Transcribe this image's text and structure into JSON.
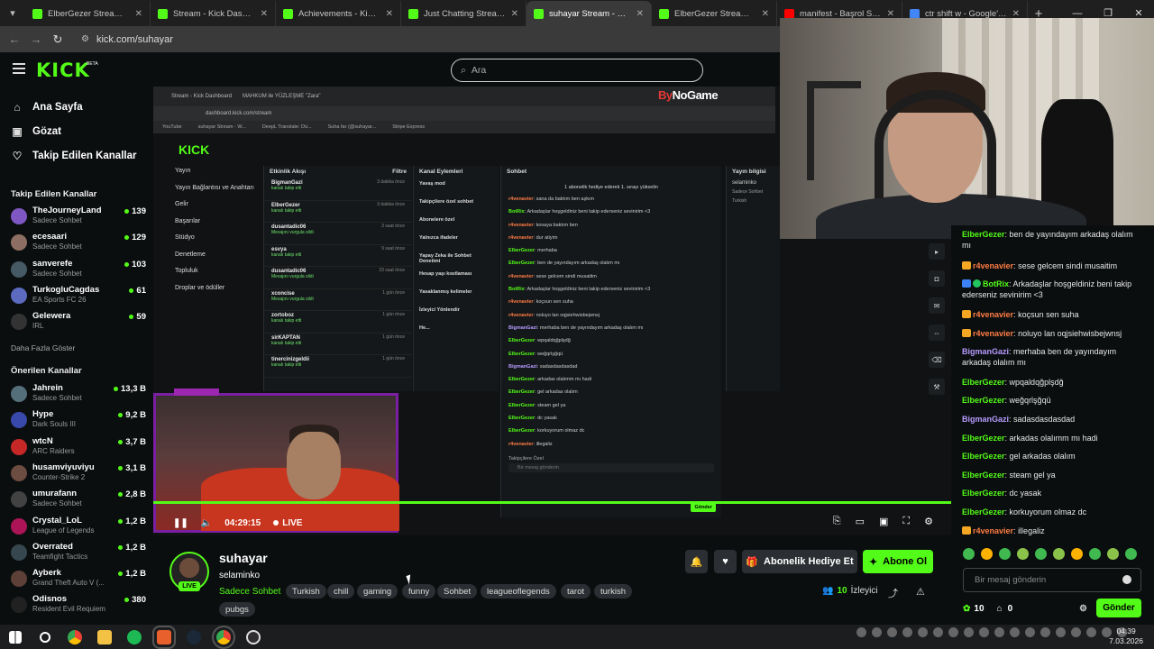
{
  "browser": {
    "tabs": [
      {
        "title": "ElberGezer Stream - Watc",
        "color": "#53fc18"
      },
      {
        "title": "Stream - Kick Dashboard",
        "color": "#53fc18"
      },
      {
        "title": "Achievements - Kick Dash",
        "color": "#53fc18"
      },
      {
        "title": "Just Chatting Streaming -",
        "color": "#53fc18"
      },
      {
        "title": "suhayar Stream - Wat",
        "color": "#53fc18",
        "active": true
      },
      {
        "title": "ElberGezer Stream - Watc",
        "color": "#53fc18"
      },
      {
        "title": "manifest - Başrol Sensin |",
        "color": "#ff0000"
      },
      {
        "title": "ctr shift w - Google'da Ar",
        "color": "#4285f4"
      }
    ],
    "new_tab_icon": "+",
    "url": "kick.com/suhayar"
  },
  "header": {
    "logo": "KICK",
    "logo_beta": "BETA",
    "search_placeholder": "Ara"
  },
  "sidebar": {
    "nav": [
      {
        "label": "Ana Sayfa",
        "icon": "home-icon"
      },
      {
        "label": "Gözat",
        "icon": "browse-icon"
      },
      {
        "label": "Takip Edilen Kanallar",
        "icon": "heart-icon"
      }
    ],
    "followed_title": "Takip Edilen Kanallar",
    "followed": [
      {
        "name": "TheJourneyLand",
        "category": "Sadece Sohbet",
        "viewers": "139",
        "color": "#7e57c2"
      },
      {
        "name": "ecesaari",
        "category": "Sadece Sohbet",
        "viewers": "129",
        "color": "#8d6e63"
      },
      {
        "name": "sanverefe",
        "category": "Sadece Sohbet",
        "viewers": "103",
        "color": "#455a64"
      },
      {
        "name": "TurkogluCagdas",
        "category": "EA Sports FC 26",
        "viewers": "61",
        "color": "#5c6bc0"
      },
      {
        "name": "Gelewera",
        "category": "IRL",
        "viewers": "59",
        "color": "#333333"
      }
    ],
    "show_more": "Daha Fazla Göster",
    "recommended_title": "Önerilen Kanallar",
    "recommended": [
      {
        "name": "Jahrein",
        "category": "Sadece Sohbet",
        "viewers": "13,3 B",
        "color": "#546e7a"
      },
      {
        "name": "Hype",
        "category": "Dark Souls III",
        "viewers": "9,2 B",
        "color": "#3949ab"
      },
      {
        "name": "wtcN",
        "category": "ARC Raiders",
        "viewers": "3,7 B",
        "color": "#c62828"
      },
      {
        "name": "husamviyuviyu",
        "category": "Counter-Strike 2",
        "viewers": "3,1 B",
        "color": "#6d4c41"
      },
      {
        "name": "umurafann",
        "category": "Sadece Sohbet",
        "viewers": "2,8 B",
        "color": "#424242"
      },
      {
        "name": "Crystal_LoL",
        "category": "League of Legends",
        "viewers": "1,2 B",
        "color": "#ad1457"
      },
      {
        "name": "Overrated",
        "category": "Teamfight Tactics",
        "viewers": "1,2 B",
        "color": "#37474f"
      },
      {
        "name": "Ayberk",
        "category": "Grand Theft Auto V (...",
        "viewers": "1,2 B",
        "color": "#5d4037"
      },
      {
        "name": "Odisnos",
        "category": "Resident Evil Requiem",
        "viewers": "380",
        "color": "#212121"
      }
    ]
  },
  "video": {
    "time": "04:29:15",
    "live": "LIVE",
    "inner": {
      "tabs": [
        "Stream - Kick Dashboard",
        "MAHKUM ile YÜZLEŞME \"Zara\""
      ],
      "url": "dashboard.kick.com/stream",
      "bookmarks": [
        "YouTube",
        "suhayar Stream - W...",
        "DeepL Translate: Dü...",
        "Suha far (@suhayar...",
        "Stripe Express"
      ],
      "sponsor_prefix": "By",
      "sponsor": "NoGame",
      "logo": "KICK",
      "nav": [
        "Yayın",
        "Yayın Bağlantısı ve Anahtarı",
        "Gelir",
        "Başarılar",
        "Stüdyo",
        "Denetleme",
        "Topluluk",
        "Droplar ve ödüller"
      ],
      "activity_title": "Etkinlik Akışı",
      "activity_filter": "Filtre",
      "activity": [
        {
          "name": "BigmanGazi",
          "sub": "kanalı takip etti",
          "time": "3 dakika önce"
        },
        {
          "name": "ElberGezer",
          "sub": "kanalı takip etti",
          "time": "3 dakika önce"
        },
        {
          "name": "dusantadic06",
          "sub": "Mesajını vurgula sildi",
          "time": "3 saat önce"
        },
        {
          "name": "esvya",
          "sub": "kanalı takip etti",
          "time": "9 saat önce"
        },
        {
          "name": "dusantadic06",
          "sub": "Mesajını vurgula sildi",
          "time": "23 saat önce"
        },
        {
          "name": "xconcise",
          "sub": "Mesajını vurgula sildi",
          "time": "1 gün önce"
        },
        {
          "name": "zortoboz",
          "sub": "kanalı takip etti",
          "time": "1 gün önce"
        },
        {
          "name": "sirKAPTAN",
          "sub": "kanalı takip etti",
          "time": "1 gün önce"
        },
        {
          "name": "tinercinizgeldii",
          "sub": "kanalı takip etti",
          "time": "1 gün önce"
        }
      ],
      "actions_title": "Kanal Eylemleri",
      "actions": [
        "Yavaş mod",
        "Takipçilere özel sohbet",
        "Abonelere özel",
        "Yalnızca ifadeler",
        "Yapay Zeka ile Sohbet Denetimi",
        "Hesap yaşı kısıtlaması",
        "Yasaklanmış kelimeler",
        "İzleyici Yönlendir",
        "He..."
      ],
      "chat_title": "Sohbet",
      "chat_banner": "1 abonelik hediye ederek 1. sırayı yükselin",
      "chat_lines": [
        {
          "user": "r4venavier",
          "text": "sana da baktım ben aşkım",
          "c": "r"
        },
        {
          "user": "BotRix",
          "text": "Arkadaşlar hoşgeldiniz beni takip ederseniz sevinirim <3",
          "c": "g"
        },
        {
          "user": "r4venavier",
          "text": "kovaya baktım ben",
          "c": "r"
        },
        {
          "user": "r4venavier",
          "text": "dur atiyim",
          "c": "r"
        },
        {
          "user": "ElberGezer",
          "text": "merhaba",
          "c": "g"
        },
        {
          "user": "ElberGezer",
          "text": "ben de yayındayım arkadaş olalım mı",
          "c": "g"
        },
        {
          "user": "r4venavier",
          "text": "sese gelcem sindi musaitim",
          "c": "r"
        },
        {
          "user": "BotRix",
          "text": "Arkadaşlar hoşgeldiniz beni takip ederseniz sevinirim <3",
          "c": "g"
        },
        {
          "user": "r4venavier",
          "text": "koçsun sen suha",
          "c": "r"
        },
        {
          "user": "r4venavier",
          "text": "noluyo lan oqjsiehwisbejwnsj",
          "c": "r"
        },
        {
          "user": "BigmanGazi",
          "text": "merhaba ben de yayındayım arkadaş olalım mı",
          "c": "p"
        },
        {
          "user": "ElberGezer",
          "text": "wpqaldqğplşdğ",
          "c": "g"
        },
        {
          "user": "ElberGezer",
          "text": "weğqrlşğqü",
          "c": "g"
        },
        {
          "user": "BigmanGazi",
          "text": "sadasdasdasdad",
          "c": "p"
        },
        {
          "user": "ElberGezer",
          "text": "arkadas olalımm mı hadi",
          "c": "g"
        },
        {
          "user": "ElberGezer",
          "text": "gel arkadas olalım",
          "c": "g"
        },
        {
          "user": "ElberGezer",
          "text": "steam gel ya",
          "c": "g"
        },
        {
          "user": "ElberGezer",
          "text": "dc yasak",
          "c": "g"
        },
        {
          "user": "ElberGezer",
          "text": "korkuyorum olmaz dc",
          "c": "g"
        },
        {
          "user": "r4venavier",
          "text": "illegaliz",
          "c": "r"
        }
      ],
      "chat_placeholder": "Bir mesaj gönderin",
      "chat_follow_label": "Takipçilere Özel",
      "chat_send": "Gönder",
      "info_title": "Yayın bilgisi",
      "info_title_value": "selaminko",
      "info_tags": [
        "Sadece Sohbet",
        "Turkish"
      ]
    }
  },
  "chat": {
    "messages": [
      {
        "user": "ElberGezer",
        "text": "ben de yayındayım arkadaş olalım mı",
        "color": "#53fc18",
        "badges": []
      },
      {
        "user": "r4venavier",
        "text": "sese gelcem sindi musaitim",
        "color": "#ff7d45",
        "badges": [
          "crown"
        ]
      },
      {
        "user": "BotRix",
        "text": "Arkadaşlar hoşgeldiniz beni takip ederseniz sevinirim <3",
        "color": "#53fc18",
        "badges": [
          "bot",
          "ok"
        ]
      },
      {
        "user": "r4venavier",
        "text": "koçsun sen suha",
        "color": "#ff7d45",
        "badges": [
          "crown"
        ]
      },
      {
        "user": "r4venavier",
        "text": "noluyo lan oqjsiehwisbejwnsj",
        "color": "#ff7d45",
        "badges": [
          "crown"
        ]
      },
      {
        "user": "BigmanGazi",
        "text": "merhaba ben de yayındayım arkadaş olalım mı",
        "color": "#b69cff",
        "badges": []
      },
      {
        "user": "ElberGezer",
        "text": "wpqaldqğplşdğ",
        "color": "#53fc18",
        "badges": []
      },
      {
        "user": "ElberGezer",
        "text": "weğqrlşğqü",
        "color": "#53fc18",
        "badges": []
      },
      {
        "user": "BigmanGazi",
        "text": "sadasdasdasdad",
        "color": "#b69cff",
        "badges": []
      },
      {
        "user": "ElberGezer",
        "text": "arkadas olalımm mı hadi",
        "color": "#53fc18",
        "badges": []
      },
      {
        "user": "ElberGezer",
        "text": "gel arkadas olalım",
        "color": "#53fc18",
        "badges": []
      },
      {
        "user": "ElberGezer",
        "text": "steam gel ya",
        "color": "#53fc18",
        "badges": []
      },
      {
        "user": "ElberGezer",
        "text": "dc yasak",
        "color": "#53fc18",
        "badges": []
      },
      {
        "user": "ElberGezer",
        "text": "korkuyorum olmaz dc",
        "color": "#53fc18",
        "badges": []
      },
      {
        "user": "r4venavier",
        "text": "illegaliz",
        "color": "#ff7d45",
        "badges": [
          "crown"
        ]
      }
    ],
    "placeholder": "Bir mesaj gönderin",
    "points": "10",
    "gifts": "0",
    "send": "Gönder"
  },
  "stream": {
    "name": "suhayar",
    "title": "selaminko",
    "live": "LIVE",
    "category": "Sadece Sohbet",
    "tags": [
      "Turkish",
      "chill",
      "gaming",
      "funny",
      "Sohbet",
      "leagueoflegends",
      "tarot",
      "turkish",
      "pubgs"
    ],
    "gift_sub": "Abonelik Hediye Et",
    "subscribe": "Abone Ol",
    "viewers": "10",
    "viewers_label": "İzleyici"
  },
  "taskbar": {
    "time": "04:39",
    "date": "7.03.2026"
  }
}
